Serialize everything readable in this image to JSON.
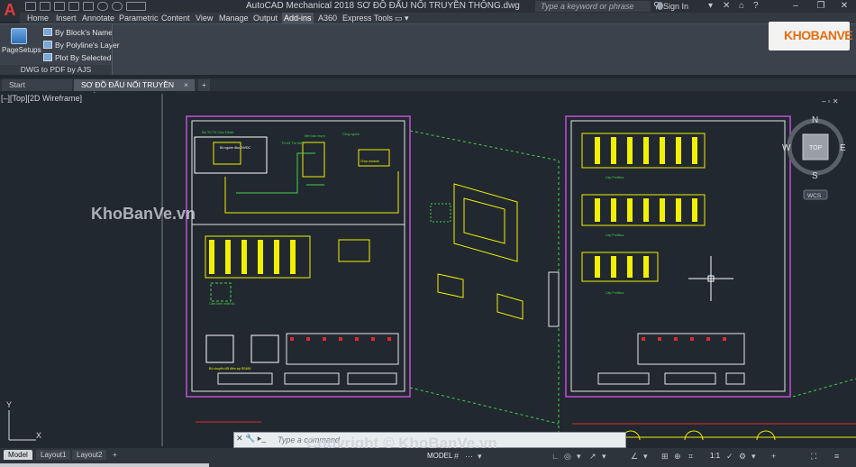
{
  "app": {
    "title": "AutoCAD Mechanical 2018    SƠ ĐỒ ĐẤU NỐI TRUYỀN THÔNG.dwg",
    "button_glyph": "A",
    "search_placeholder": "Type a keyword or phrase",
    "signin_label": "Sign In",
    "window_controls": {
      "minimize": "–",
      "maximize": "❐",
      "close": "✕"
    }
  },
  "ribbon_tabs": [
    "Home",
    "Insert",
    "Annotate",
    "Parametric",
    "Content",
    "View",
    "Manage",
    "Output",
    "Add-ins",
    "A360",
    "Express Tools",
    "▭ ▾"
  ],
  "ribbon_active_tab": "Add-ins",
  "ribbon_panel": {
    "large_button_label": "PageSetups",
    "items": [
      "By Block's Name",
      "By Polyline's Layer",
      "Plot By Selected"
    ],
    "panel_title": "DWG to PDF by AJS"
  },
  "document_tabs": {
    "start": "Start",
    "active": "SƠ ĐỒ ĐẤU NỐI TRUYỀN THÔNG*",
    "close": "×",
    "add": "+"
  },
  "viewport": {
    "label": "[–][Top][2D Wireframe]",
    "controls": "–  ▫  ✕",
    "viewcube": {
      "top_label": "TOP",
      "north": "N",
      "south": "S",
      "east": "E",
      "west": "W",
      "wcs": "WCS"
    },
    "ucs": {
      "x": "X",
      "y": "Y"
    }
  },
  "drawing_text": {
    "sheet1": [
      "Bộ Tủ Tủ Cầu Nhiệt",
      "Tủ 03 Tín hiệu",
      "Bộ nguồn đầu 24VDC",
      "Đèn báo mạch",
      "Cộng nguồn",
      "Chọn module",
      "Cảm biến nhiệt độ",
      "Bộ chuyển đổi điện áp RS485"
    ],
    "sheet2": [
      "Cáp Profibus",
      "Cáp Profibus",
      "Cáp Profibus",
      "Cáp Profibus"
    ]
  },
  "watermarks": {
    "logo": "KHOBANVE",
    "mid": "KhoBanVe.vn",
    "bottom": "Copyright © KhoBanVe.vn"
  },
  "command_line": {
    "prompt": "Type a command",
    "buttons": "✕  🔧  ▸_"
  },
  "status_bar": {
    "layout_tabs": [
      "Model",
      "Layout1",
      "Layout2"
    ],
    "active_layout": "Model",
    "add_layout": "+",
    "model_label": "MODEL",
    "scale": "1:1",
    "icons": [
      "#",
      "⋯",
      "▾",
      "∟",
      "◎",
      "▾",
      "↗",
      "▾",
      "∠",
      "▾",
      "⊞",
      "⊕",
      "⌗",
      "✓",
      "⚙",
      "▾",
      "+",
      "⛶",
      "≡"
    ]
  },
  "colors": {
    "canvas": "#212830",
    "sheet_border": "#c44fd8",
    "frame": "#ffffff",
    "yellow": "#f0f000",
    "green": "#46d04b",
    "red": "#e02a2a",
    "accent_orange": "#e46e12"
  }
}
